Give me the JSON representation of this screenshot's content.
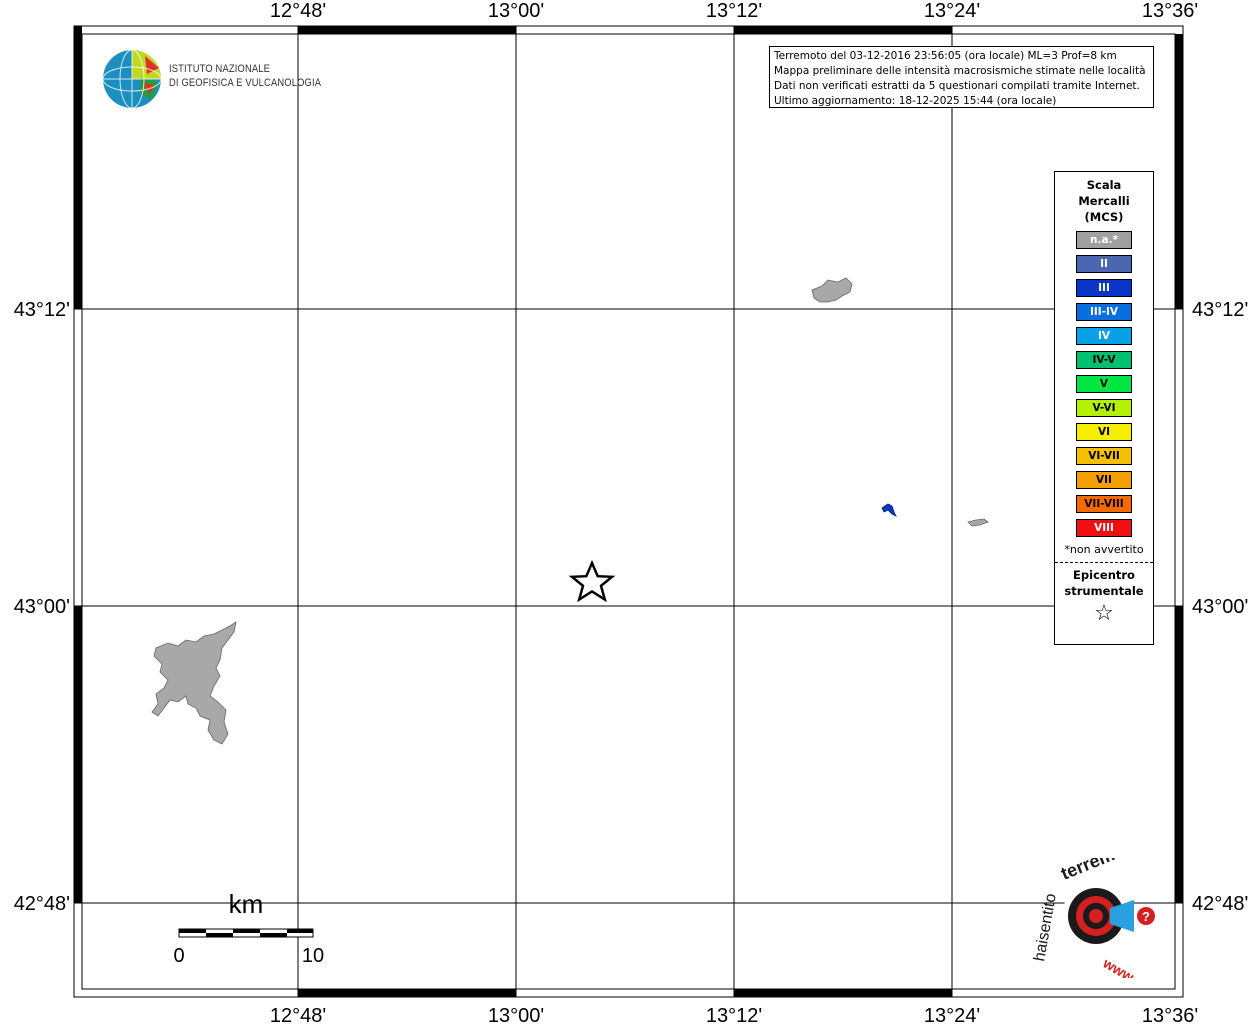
{
  "map": {
    "lon_ticks": [
      "12°48'",
      "13°00'",
      "13°12'",
      "13°24'",
      "13°36'"
    ],
    "lat_ticks": [
      "43°12'",
      "43°00'",
      "42°48'"
    ]
  },
  "info": {
    "lines": [
      "Terremoto del 03-12-2016 23:56:05 (ora locale) ML=3 Prof=8 km",
      "Mappa preliminare delle intensità macrosismiche stimate nelle località",
      "Dati non verificati estratti da 5 questionari compilati tramite Internet.",
      "Ultimo aggiornamento: 18-12-2025 15:44 (ora locale)"
    ]
  },
  "legend": {
    "title": [
      "Scala",
      "Mercalli",
      "(MCS)"
    ],
    "items": [
      {
        "label": "n.a.*",
        "color": "#a0a0a0"
      },
      {
        "label": "II",
        "color": "#4a66b0"
      },
      {
        "label": "III",
        "color": "#0a36c8"
      },
      {
        "label": "III-IV",
        "color": "#0a6ee0"
      },
      {
        "label": "IV",
        "color": "#0aa0e8"
      },
      {
        "label": "IV-V",
        "color": "#00c070"
      },
      {
        "label": "V",
        "color": "#00e640"
      },
      {
        "label": "V-VI",
        "color": "#b4f000"
      },
      {
        "label": "VI",
        "color": "#f5f000"
      },
      {
        "label": "VI-VII",
        "color": "#f5c000"
      },
      {
        "label": "VII",
        "color": "#f5a000"
      },
      {
        "label": "VII-VIII",
        "color": "#f56a00"
      },
      {
        "label": "VIII",
        "color": "#f01010"
      }
    ],
    "note": "*non avvertito",
    "epicenter": [
      "Epicentro",
      "strumentale"
    ],
    "epicenter_symbol": "☆"
  },
  "scale_bar": {
    "unit": "km",
    "labels": [
      "0",
      "10"
    ]
  },
  "logos": {
    "ingv": [
      "ISTITUTO NAZIONALE",
      "DI GEOFISICA E VULCANOLOGIA"
    ],
    "hst": {
      "top": "terremoto.it",
      "left": "haisentito",
      "bottom": "www.",
      "q": "?"
    }
  },
  "points": [
    {
      "intensity": "III",
      "color": "#0a36c8"
    }
  ]
}
